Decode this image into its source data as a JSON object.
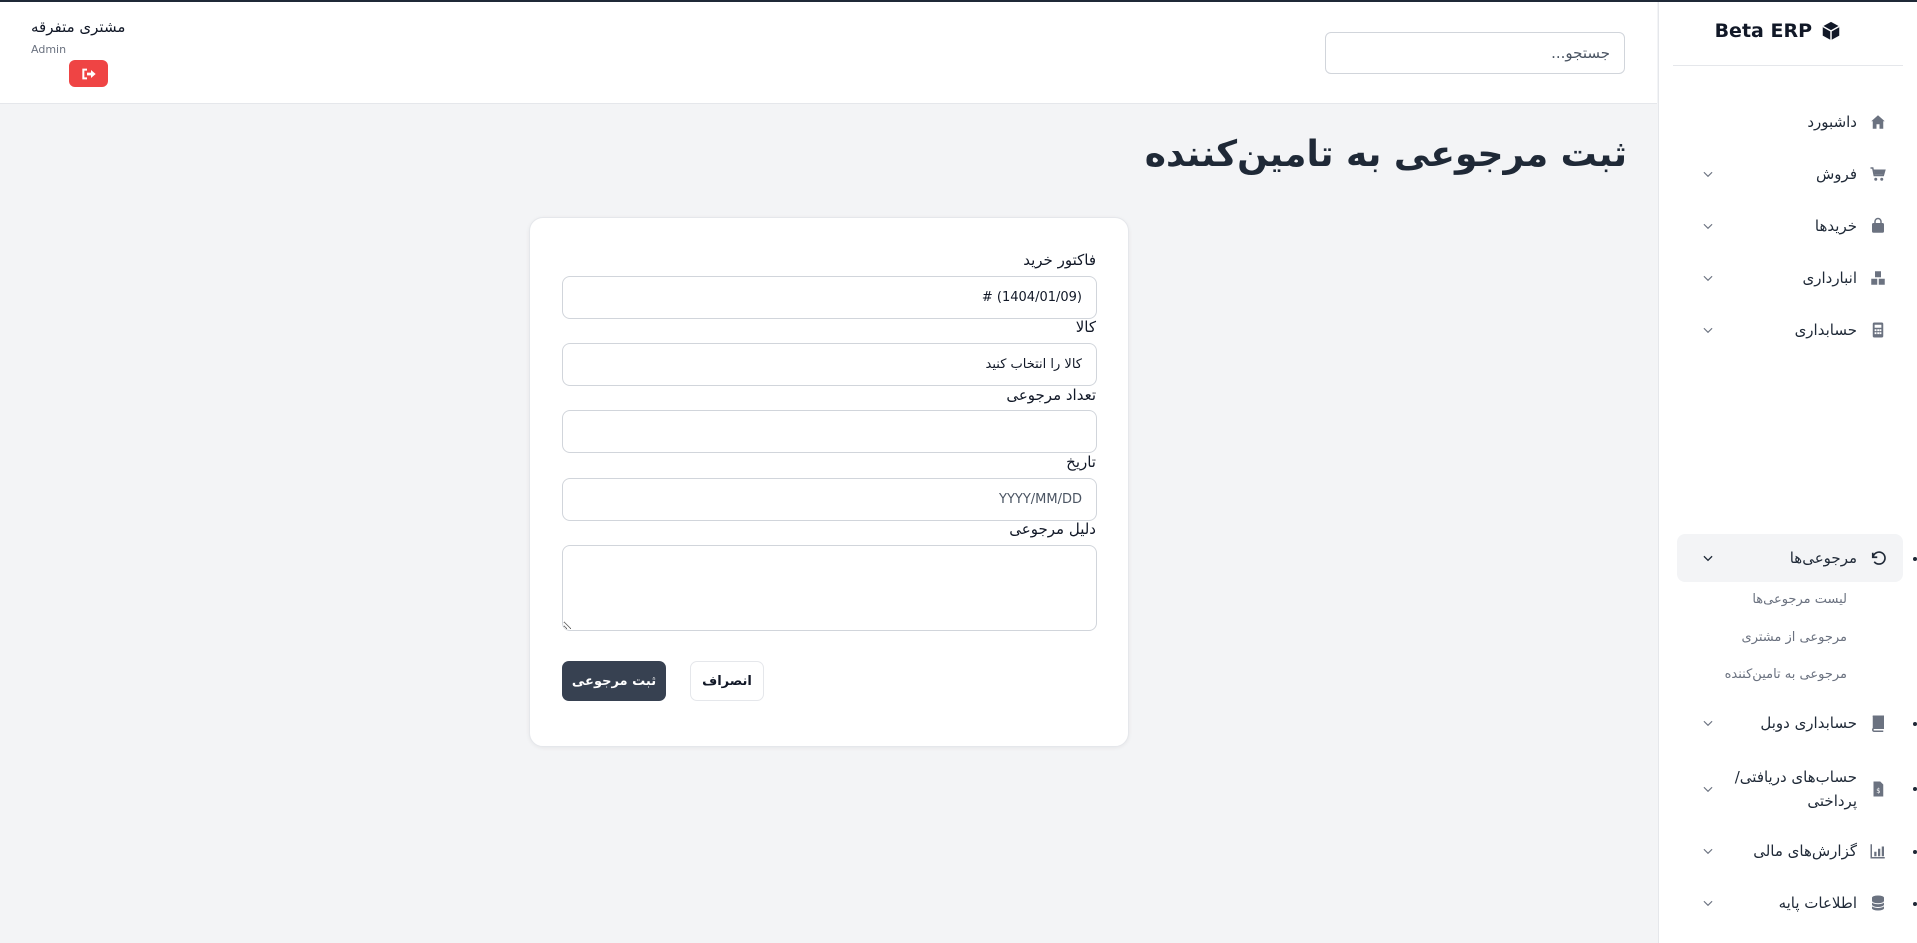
{
  "brand": {
    "name": "Beta ERP",
    "icon": "cube-icon"
  },
  "header": {
    "search_placeholder": "جستجو...",
    "user_name": "مشتری متفرقه",
    "user_role": "Admin",
    "logout_icon": "logout-icon"
  },
  "page": {
    "title": "ثبت مرجوعی به تامین‌کننده"
  },
  "sidebar": {
    "items": [
      {
        "label": "داشبورد",
        "icon": "home-icon"
      },
      {
        "label": "فروش",
        "icon": "cart-icon"
      },
      {
        "label": "خریدها",
        "icon": "bag-icon"
      },
      {
        "label": "انبارداری",
        "icon": "warehouse-icon"
      },
      {
        "label": "حسابداری",
        "icon": "calculator-icon"
      },
      {
        "label": "مرجوعی‌ها",
        "icon": "undo-icon"
      },
      {
        "label": "حسابداری دوبل",
        "icon": "book-icon"
      },
      {
        "label": "حساب‌های دریافتی/پرداختی",
        "icon": "invoice-icon"
      },
      {
        "label": "گزارش‌های مالی",
        "icon": "chart-icon"
      },
      {
        "label": "اطلاعات پایه",
        "icon": "database-icon"
      }
    ],
    "returns_sub": [
      {
        "label": "لیست مرجوعی‌ها"
      },
      {
        "label": "مرجوعی از مشتری"
      },
      {
        "label": "مرجوعی به تامین‌کننده"
      }
    ]
  },
  "form": {
    "invoice_label": "فاکتور خرید",
    "invoice_value": "# (1404/01/09)",
    "product_label": "کالا",
    "product_value": "کالا را انتخاب کنید",
    "qty_label": "تعداد مرجوعی",
    "qty_value": "",
    "date_label": "تاریخ",
    "date_placeholder": "YYYY/MM/DD",
    "reason_label": "دلیل مرجوعی",
    "submit_label": "ثبت مرجوعی",
    "cancel_label": "انصراف"
  }
}
